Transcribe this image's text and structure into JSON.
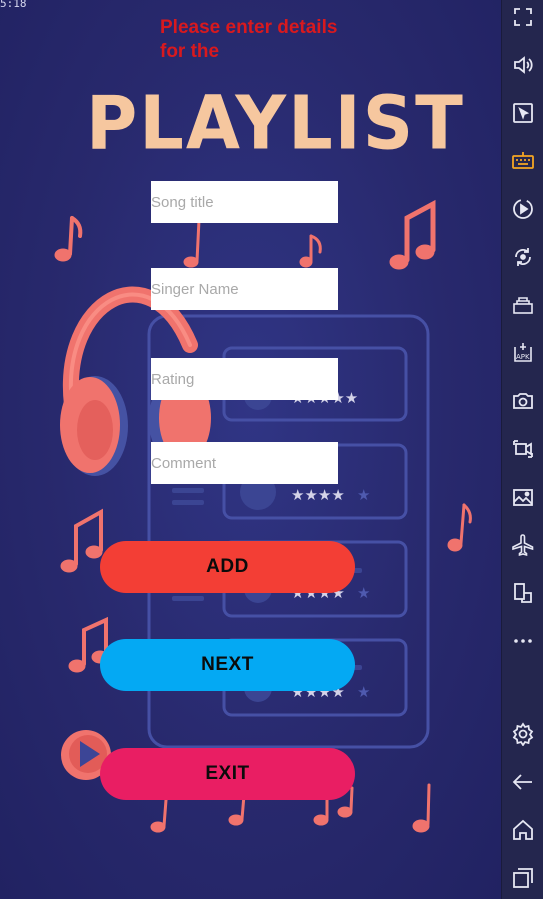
{
  "status_bar": {
    "time": "5:18"
  },
  "header": {
    "prompt": "Please enter details for the",
    "title": "PLAYLIST"
  },
  "form": {
    "song_title_placeholder": "Song title",
    "singer_name_placeholder": "Singer Name",
    "rating_placeholder": "Rating",
    "comment_placeholder": "Comment"
  },
  "buttons": {
    "add_label": "ADD",
    "next_label": "NEXT",
    "exit_label": "EXIT"
  },
  "colors": {
    "background": "#28296d",
    "prompt_text": "#d8191e",
    "title_text": "#f6c79f",
    "add_button": "#f33e35",
    "next_button": "#04a9f3",
    "exit_button": "#e91e63",
    "music_note": "#f0736d",
    "sidebar": "#24264e"
  },
  "sidebar_icons": [
    "fullscreen-icon",
    "volume-icon",
    "pointer-icon",
    "keyboard-icon",
    "record-icon",
    "rotate-icon",
    "build-icon",
    "apk-icon",
    "screenshot-icon",
    "video-icon",
    "gallery-icon",
    "airplane-icon",
    "multi-screen-icon",
    "more-icon",
    "settings-icon",
    "back-icon",
    "home-icon",
    "recents-icon"
  ]
}
